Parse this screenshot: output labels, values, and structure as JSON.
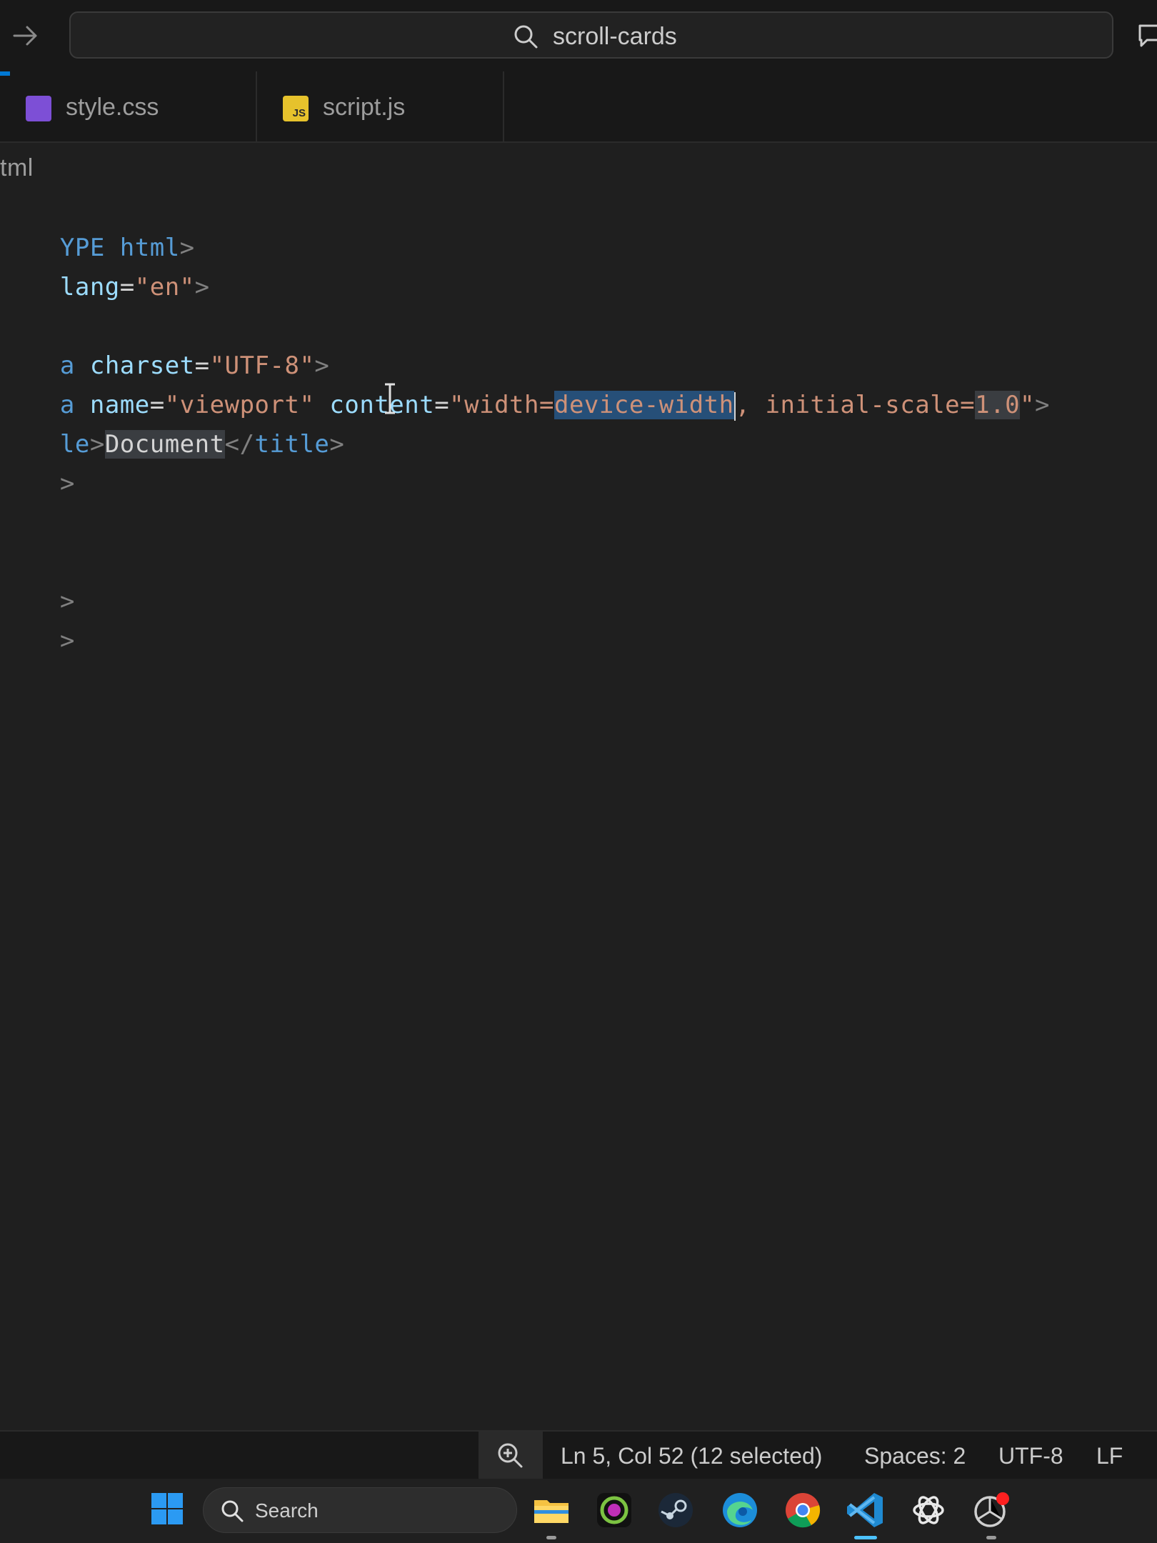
{
  "titlebar": {
    "search_text": "scroll-cards"
  },
  "tabs": [
    {
      "label": "style.css",
      "icon": "css-file-icon"
    },
    {
      "label": "script.js",
      "icon": "js-file-icon",
      "badge": "JS"
    }
  ],
  "editor": {
    "breadcrumb": "tml",
    "lines": [
      {
        "c1": "YPE",
        "c2": " html",
        "c3": ">"
      },
      {
        "c1": "lang",
        "c2": "=",
        "c3": "\"en\"",
        "c4": ">"
      },
      {
        "c1": "a",
        "c2": " charset",
        "c3": "=",
        "c4": "\"UTF-8\"",
        "c5": ">"
      },
      {
        "c1": "a",
        "c2": " name",
        "c3": "=",
        "c4": "\"viewport\"",
        "c5": " content",
        "c6": "=",
        "c7": "\"width=",
        "c8": "device-width",
        "c9": ", initial-scale=",
        "c10": "1.0",
        "c11": "\"",
        "c12": ">"
      },
      {
        "c1": "le",
        "c2": ">",
        "c3": "Document",
        "c4": "</",
        "c5": "title",
        "c6": ">"
      },
      {
        "c1": ">"
      },
      {
        "c1": ">"
      },
      {
        "c1": ">"
      }
    ]
  },
  "statusbar": {
    "position": "Ln 5, Col 52 (12 selected)",
    "spaces": "Spaces: 2",
    "encoding": "UTF-8",
    "eol": "LF"
  },
  "taskbar": {
    "search_label": "Search",
    "apps": [
      "file-explorer-icon",
      "obs-icon",
      "steam-icon",
      "edge-icon",
      "chrome-icon",
      "vscode-icon",
      "chatgpt-icon",
      "other-app-icon"
    ]
  },
  "colors": {
    "tag": "#569cd6",
    "attribute": "#9cdcfe",
    "string": "#ce9178",
    "selection": "#264f78",
    "accent": "#0078d4"
  }
}
